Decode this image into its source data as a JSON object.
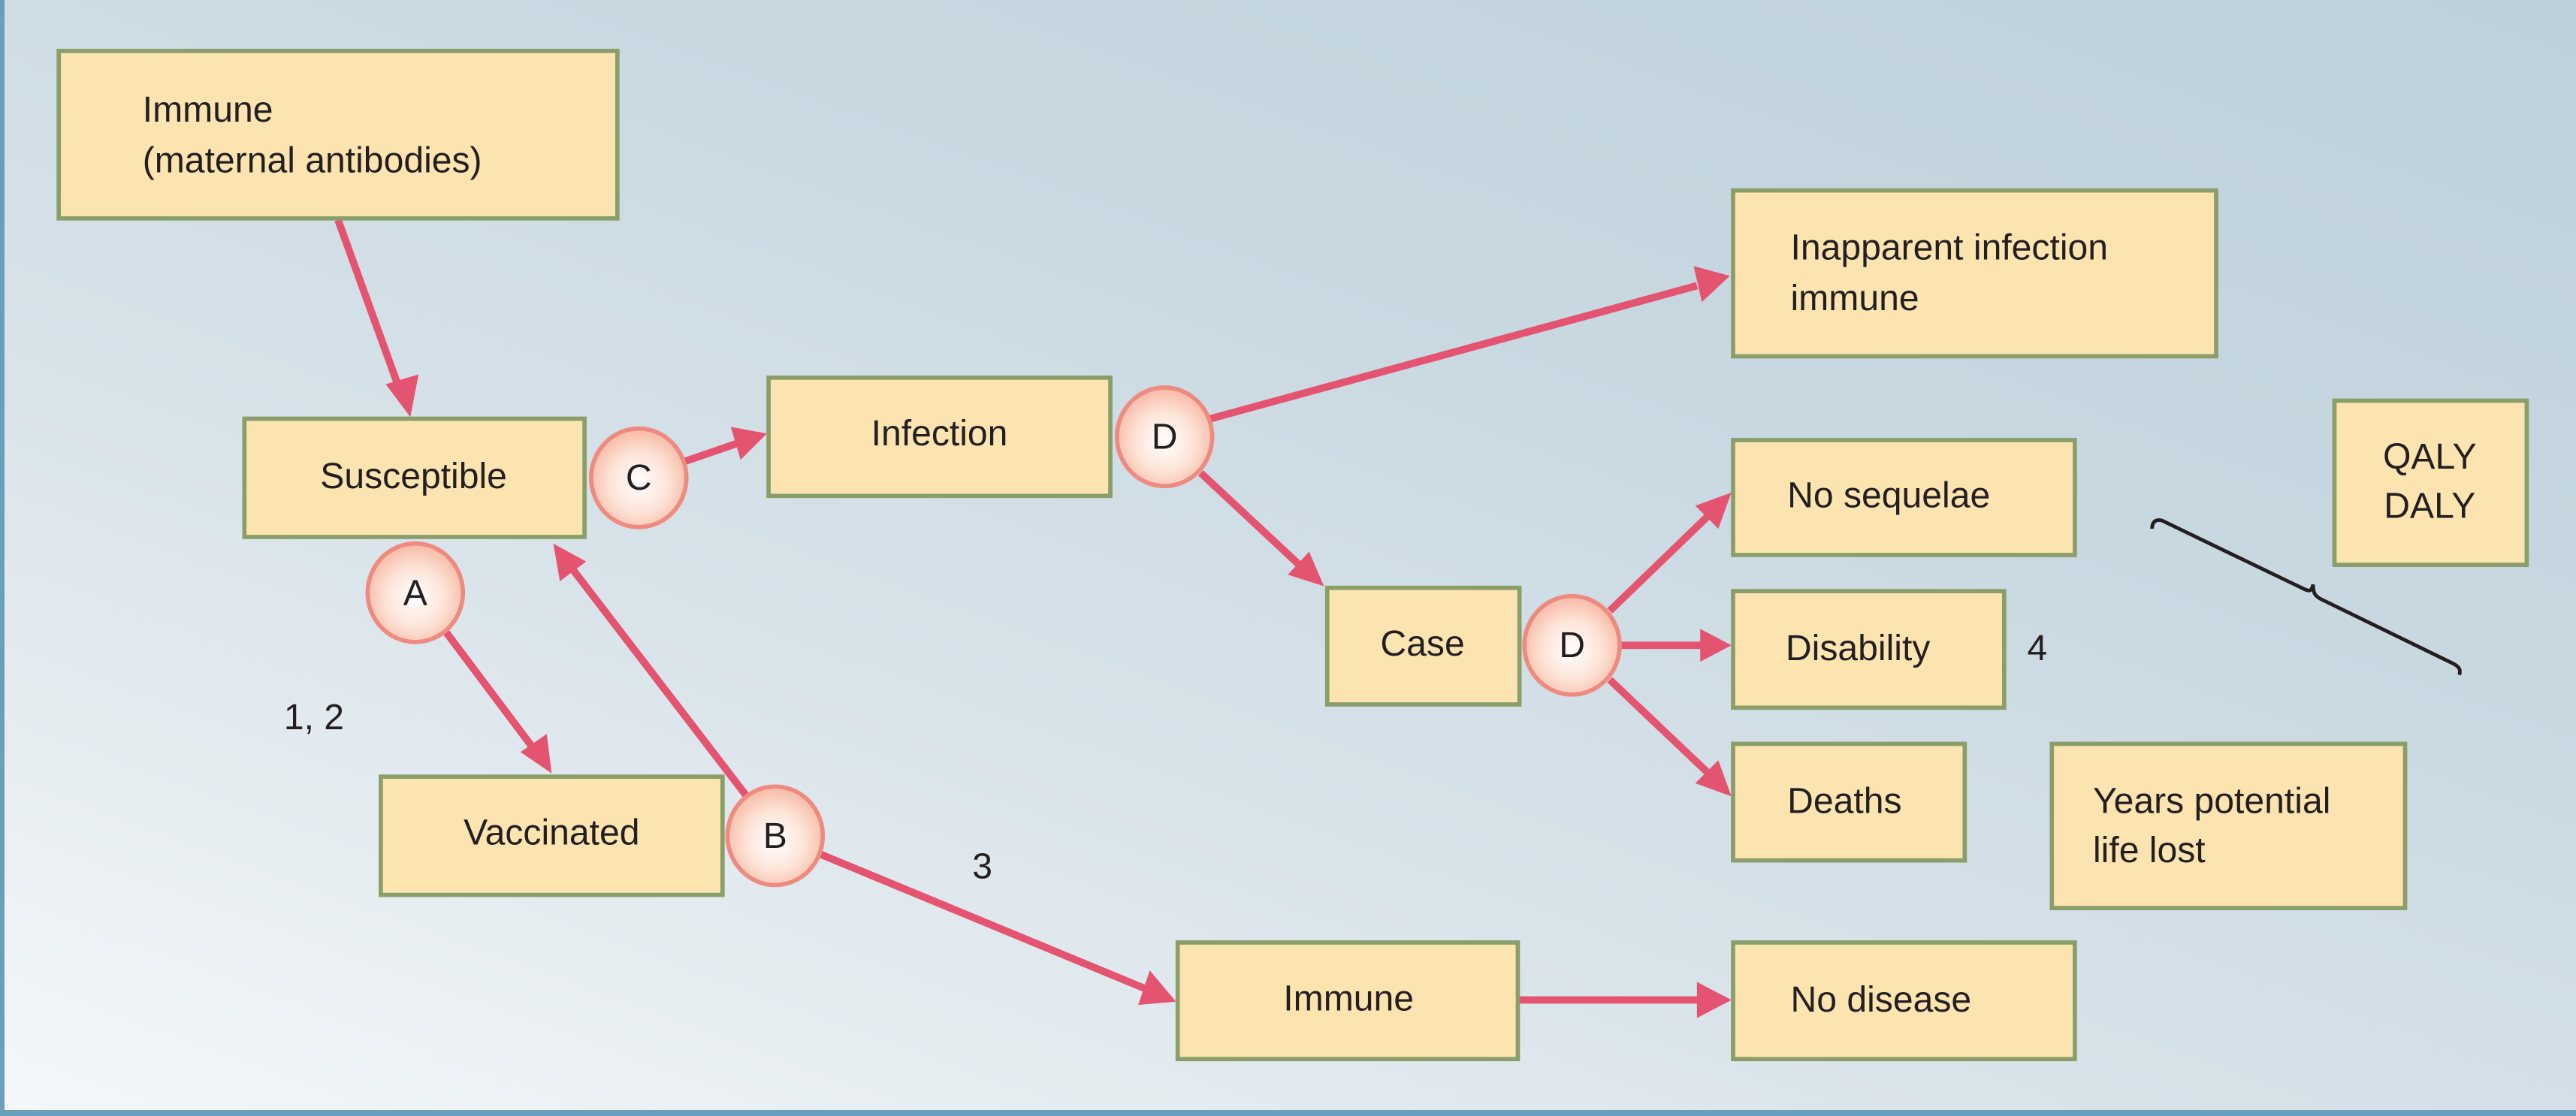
{
  "diagram": {
    "type": "flow",
    "colors": {
      "box_fill": "#fbe4b0",
      "box_border": "#8a9e6a",
      "arrow": "#e4536f",
      "circle_border": "#ef8a80",
      "frame": "#6a9fbb"
    },
    "boxes": {
      "immune_maternal": [
        "Immune",
        "(maternal antibodies)"
      ],
      "susceptible": [
        "Susceptible"
      ],
      "infection": [
        "Infection"
      ],
      "inapparent": [
        "Inapparent infection",
        "immune"
      ],
      "case": [
        "Case"
      ],
      "no_sequelae": [
        "No sequelae"
      ],
      "disability": [
        "Disability"
      ],
      "deaths": [
        "Deaths"
      ],
      "qaly_daly": [
        "QALY",
        "DALY"
      ],
      "ypll": [
        "Years potential",
        "life lost"
      ],
      "vaccinated": [
        "Vaccinated"
      ],
      "immune_vacc": [
        "Immune"
      ],
      "no_disease": [
        "No disease"
      ]
    },
    "circles": {
      "a": "A",
      "b": "B",
      "c": "C",
      "d1": "D",
      "d2": "D"
    },
    "notes": {
      "n12": "1, 2",
      "n3": "3",
      "n4": "4"
    },
    "edges": [
      {
        "from": "Immune (maternal antibodies)",
        "to": "Susceptible"
      },
      {
        "from": "Susceptible",
        "via": "C",
        "to": "Infection"
      },
      {
        "from": "Infection",
        "via": "D",
        "to": "Inapparent infection immune"
      },
      {
        "from": "Infection",
        "via": "D",
        "to": "Case"
      },
      {
        "from": "Case",
        "via": "D",
        "to": "No sequelae"
      },
      {
        "from": "Case",
        "via": "D",
        "to": "Disability"
      },
      {
        "from": "Case",
        "via": "D",
        "to": "Deaths"
      },
      {
        "from": "Susceptible",
        "via": "A",
        "to": "Vaccinated"
      },
      {
        "from": "Vaccinated",
        "via": "B",
        "to": "Susceptible"
      },
      {
        "from": "Vaccinated",
        "via": "B",
        "to": "Immune"
      },
      {
        "from": "Immune",
        "to": "No disease"
      }
    ]
  }
}
